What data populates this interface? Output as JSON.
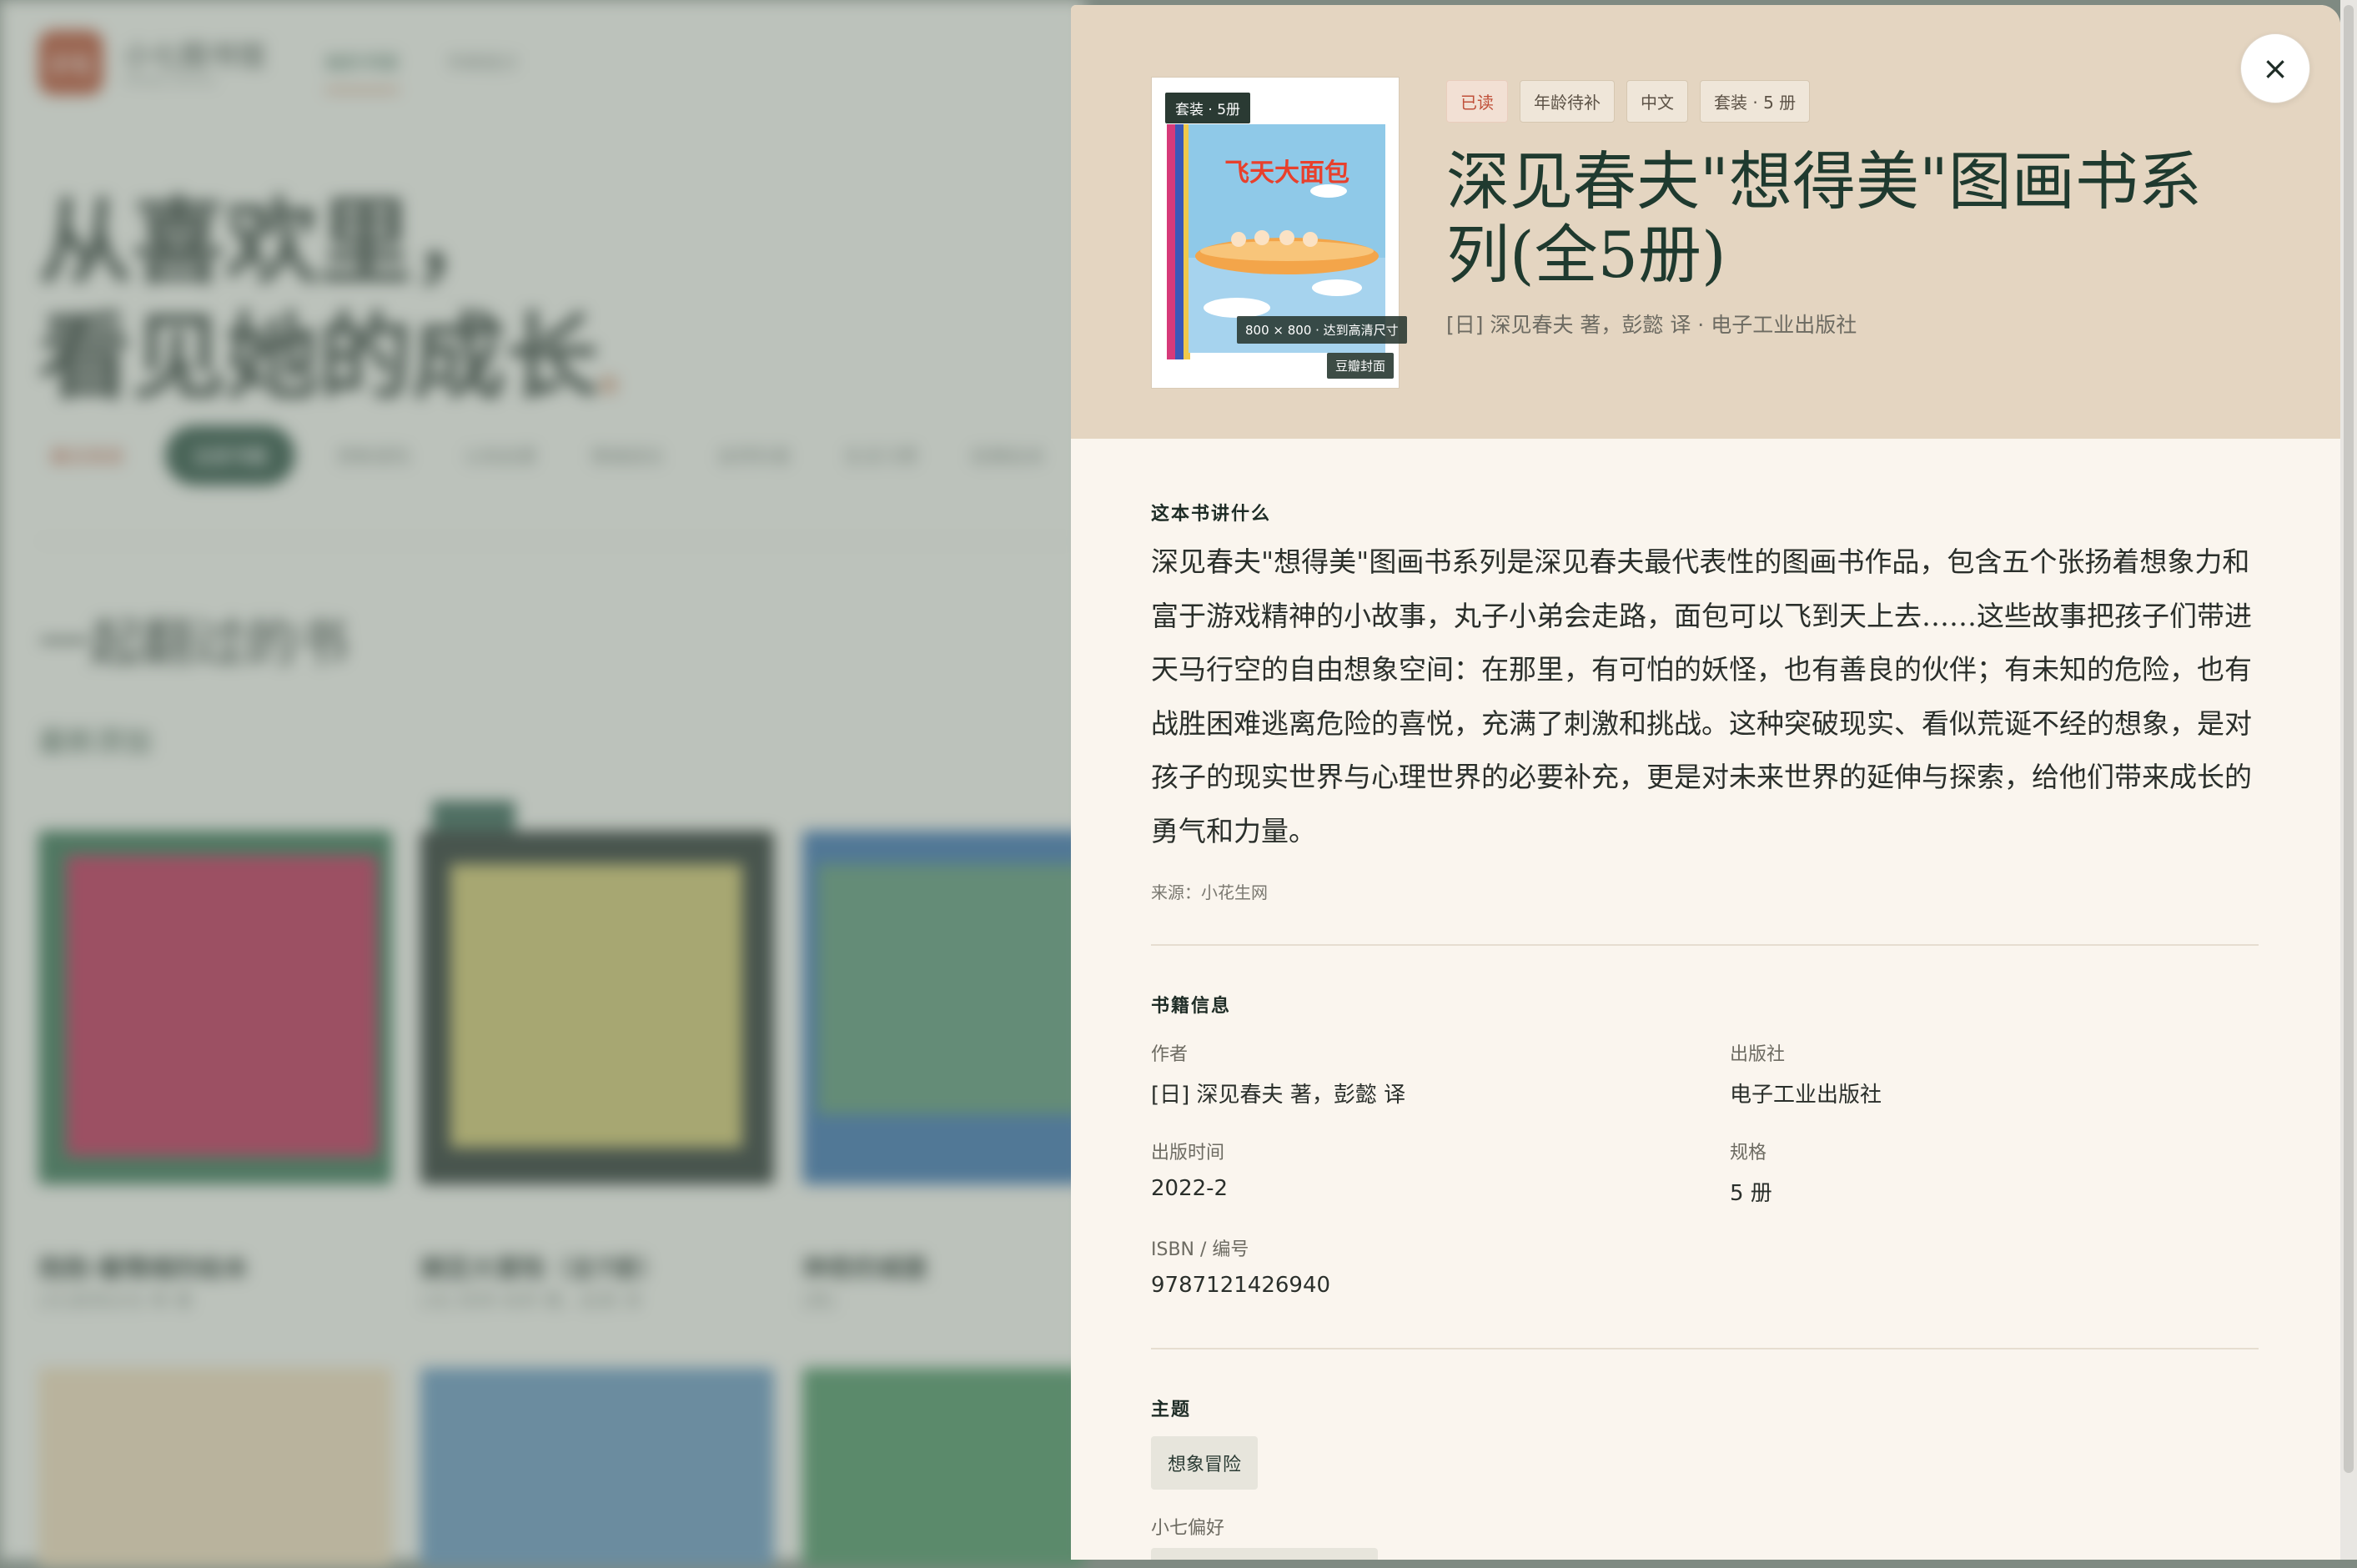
{
  "background": {
    "logo": "小七",
    "brand": "小七图书馆",
    "brand_sub": "Xiaoqi Library",
    "nav": [
      "她的书架",
      "书单统计"
    ],
    "hero_line1": "从喜欢里，",
    "hero_line2": "看见她的成长",
    "hero_dot": "。",
    "chips": [
      "最近阅读",
      "全部书籍",
      "想象冒险",
      "认知启蒙",
      "情绪成长",
      "自然科普",
      "生活习惯",
      "经典绘本"
    ],
    "section_title": "一起翻过的书",
    "subsection_title": "最新添加",
    "cards": [
      {
        "title": "抱抱·着情绪的绘本",
        "sub": "[日]宫西达也 等 著"
      },
      {
        "title": "豌豆大冒险（全7册）",
        "sub": "[法] 凯特·肖邦 著，赵英 译"
      },
      {
        "title": "神奇的城堡",
        "sub": "[英]"
      }
    ]
  },
  "modal": {
    "close_label": "×",
    "cover": {
      "badge": "套装 · 5册",
      "size_note": "800 × 800 · 达到高清尺寸",
      "source": "豆瓣封面",
      "art_title": "飞天大面包"
    },
    "tags": [
      "已读",
      "年龄待补",
      "中文",
      "套装 · 5 册"
    ],
    "title": "深见春夫\"想得美\"图画书系列(全5册)",
    "meta": "[日] 深见春夫 著，彭懿 译 · 电子工业出版社",
    "summary_label": "这本书讲什么",
    "summary": "深见春夫\"想得美\"图画书系列是深见春夫最代表性的图画书作品，包含五个张扬着想象力和富于游戏精神的小故事，丸子小弟会走路，面包可以飞到天上去……这些故事把孩子们带进天马行空的自由想象空间：在那里，有可怕的妖怪，也有善良的伙伴；有未知的危险，也有战胜困难逃离危险的喜悦，充满了刺激和挑战。这种突破现实、看似荒诞不经的想象，是对孩子的现实世界与心理世界的必要补充，更是对未来世界的延伸与探索，给他们带来成长的勇气和力量。",
    "summary_source": "来源：小花生网",
    "info_label": "书籍信息",
    "info": [
      {
        "key": "作者",
        "value": "[日] 深见春夫 著，彭懿 译"
      },
      {
        "key": "出版社",
        "value": "电子工业出版社"
      },
      {
        "key": "出版时间",
        "value": "2022-2"
      },
      {
        "key": "规格",
        "value": "5 册"
      },
      {
        "key": "ISBN / 编号",
        "value": "9787121426940"
      }
    ],
    "theme_label": "主题",
    "theme_chip": "想象冒险",
    "pref_label": "小七偏好"
  },
  "colors": {
    "accent_green": "#1f3a2f",
    "header_bg": "#e4d5c1",
    "modal_bg": "#faf5ee",
    "read_tag": "#c0503a"
  }
}
